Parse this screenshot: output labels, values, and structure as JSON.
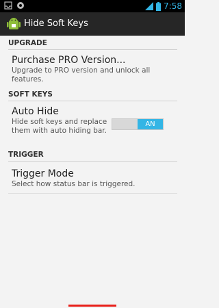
{
  "status_bar": {
    "time": "7:58"
  },
  "action_bar": {
    "title": "Hide Soft Keys"
  },
  "sections": {
    "upgrade": {
      "header": "UPGRADE",
      "title": "Purchase PRO Version...",
      "summary": "Upgrade to PRO version and unlock all features."
    },
    "soft_keys": {
      "header": "SOFT KEYS",
      "title": "Auto Hide",
      "summary": "Hide soft keys and replace them with auto hiding bar.",
      "toggle_label": "AN",
      "toggle_on": true
    },
    "trigger": {
      "header": "TRIGGER",
      "title": "Trigger Mode",
      "summary": "Select how status bar is triggered."
    }
  },
  "colors": {
    "accent": "#33b5e5",
    "action_bar": "#262626",
    "background": "#f3f3f3"
  }
}
